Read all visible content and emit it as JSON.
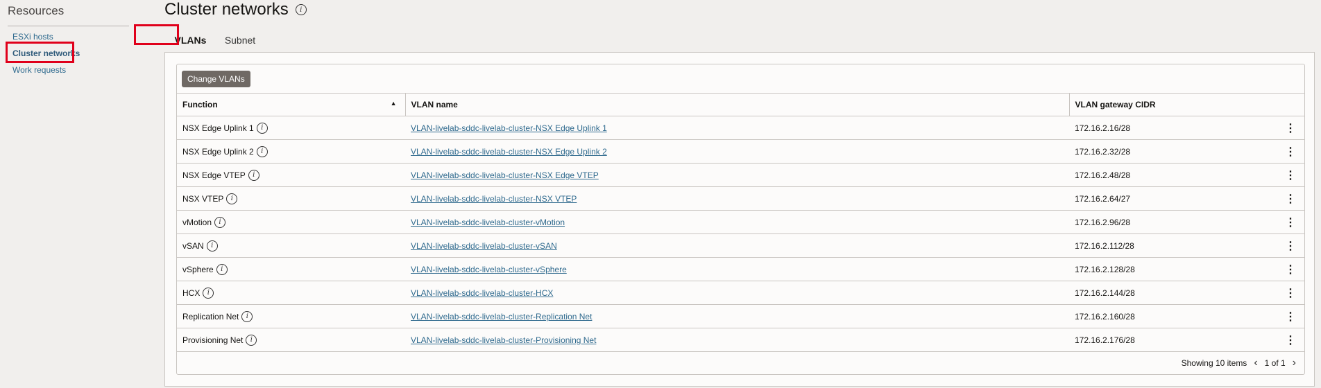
{
  "sidebar": {
    "title": "Resources",
    "items": [
      {
        "label": "ESXi hosts"
      },
      {
        "label": "Cluster networks",
        "active": true
      },
      {
        "label": "Work requests"
      }
    ]
  },
  "page": {
    "title": "Cluster networks"
  },
  "tabs": [
    {
      "label": "VLANs",
      "active": true
    },
    {
      "label": "Subnet"
    }
  ],
  "toolbar": {
    "change_label": "Change VLANs"
  },
  "table": {
    "columns": [
      "Function",
      "VLAN name",
      "VLAN gateway CIDR"
    ],
    "rows": [
      {
        "function": "NSX Edge Uplink 1",
        "name": "VLAN-livelab-sddc-livelab-cluster-NSX Edge Uplink 1",
        "cidr": "172.16.2.16/28"
      },
      {
        "function": "NSX Edge Uplink 2",
        "name": "VLAN-livelab-sddc-livelab-cluster-NSX Edge Uplink 2",
        "cidr": "172.16.2.32/28"
      },
      {
        "function": "NSX Edge VTEP",
        "name": "VLAN-livelab-sddc-livelab-cluster-NSX Edge VTEP",
        "cidr": "172.16.2.48/28"
      },
      {
        "function": "NSX VTEP",
        "name": "VLAN-livelab-sddc-livelab-cluster-NSX VTEP",
        "cidr": "172.16.2.64/27"
      },
      {
        "function": "vMotion",
        "name": "VLAN-livelab-sddc-livelab-cluster-vMotion",
        "cidr": "172.16.2.96/28"
      },
      {
        "function": "vSAN",
        "name": "VLAN-livelab-sddc-livelab-cluster-vSAN",
        "cidr": "172.16.2.112/28"
      },
      {
        "function": "vSphere",
        "name": "VLAN-livelab-sddc-livelab-cluster-vSphere",
        "cidr": "172.16.2.128/28"
      },
      {
        "function": "HCX",
        "name": "VLAN-livelab-sddc-livelab-cluster-HCX",
        "cidr": "172.16.2.144/28"
      },
      {
        "function": "Replication Net",
        "name": "VLAN-livelab-sddc-livelab-cluster-Replication Net",
        "cidr": "172.16.2.160/28"
      },
      {
        "function": "Provisioning Net",
        "name": "VLAN-livelab-sddc-livelab-cluster-Provisioning Net",
        "cidr": "172.16.2.176/28"
      }
    ]
  },
  "footer": {
    "showing": "Showing 10 items",
    "page": "1 of 1"
  },
  "colors": {
    "highlight": "#e0001b",
    "link": "#2f6a8e"
  }
}
